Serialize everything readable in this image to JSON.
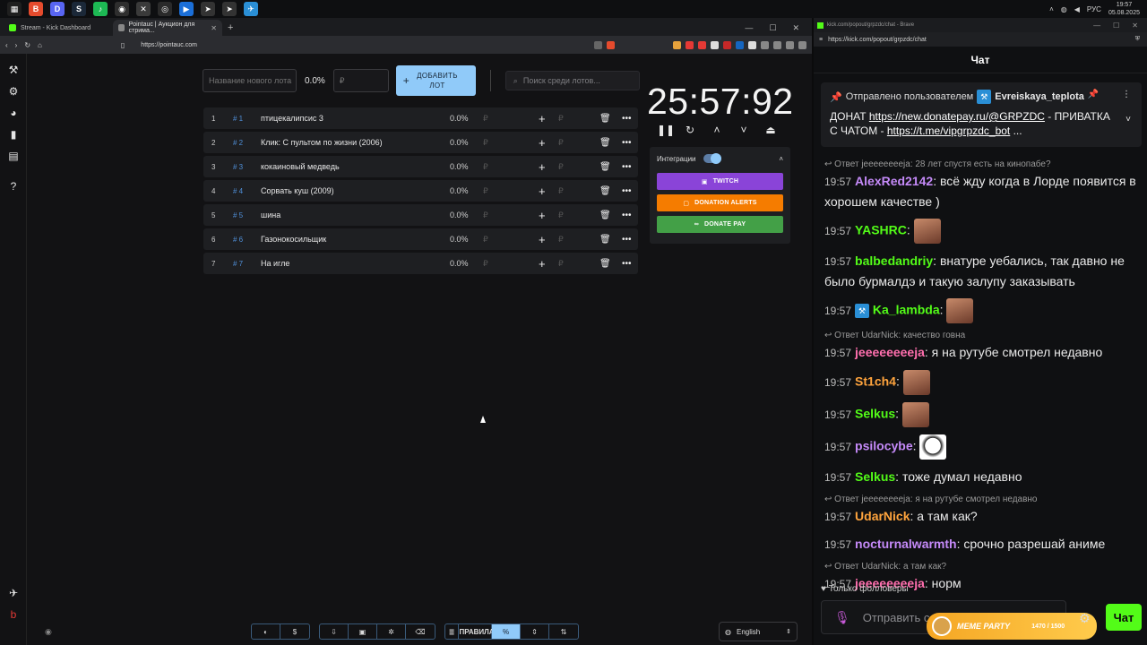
{
  "taskbar": {
    "lang": "РУС",
    "time": "19:57",
    "date": "05.08.2025"
  },
  "left_browser": {
    "tabs": [
      {
        "label": "Stream - Kick Dashboard"
      },
      {
        "label": "Pointauc | Аукцион для стрима..."
      }
    ],
    "url": "https://pointauc.com"
  },
  "auction": {
    "lot_name_placeholder": "Название нового лота",
    "new_lot_pct": "0.0%",
    "amount_placeholder": "₽",
    "add_button_line1": "ДОБАВИТЬ",
    "add_button_line2": "ЛОТ",
    "search_placeholder": "Поиск среди лотов...",
    "timer": "25:57:92",
    "integrations": {
      "label": "Интеграции",
      "twitch": "TWITCH",
      "donation_alerts": "DONATION ALERTS",
      "donate_pay": "DONATE PAY"
    },
    "lots": [
      {
        "idx": "1",
        "hash": "# 1",
        "name": "птицекалипсис 3",
        "pct": "0.0%",
        "rub": "₽"
      },
      {
        "idx": "2",
        "hash": "# 2",
        "name": "Клик: С пультом по жизни (2006)",
        "pct": "0.0%",
        "rub": "₽"
      },
      {
        "idx": "3",
        "hash": "# 3",
        "name": "кокаиновый медведь",
        "pct": "0.0%",
        "rub": "₽"
      },
      {
        "idx": "4",
        "hash": "# 4",
        "name": "Сорвать куш (2009)",
        "pct": "0.0%",
        "rub": "₽"
      },
      {
        "idx": "5",
        "hash": "# 5",
        "name": "шина",
        "pct": "0.0%",
        "rub": "₽"
      },
      {
        "idx": "6",
        "hash": "# 6",
        "name": "Газонокосильщик",
        "pct": "0.0%",
        "rub": "₽"
      },
      {
        "idx": "7",
        "hash": "# 7",
        "name": "На игле",
        "pct": "0.0%",
        "rub": "₽"
      }
    ],
    "rules_label": "ПРАВИЛА",
    "language": "English"
  },
  "right_browser": {
    "title": "kick.com/popout/grpzdc/chat - Brave",
    "url": "https://kick.com/popout/grpzdc/chat",
    "chat_header": "Чат",
    "pinned": {
      "by_prefix": "Отправлено пользователем",
      "by_user": "Evreiskaya_teplota",
      "text_1": "ДОНАТ ",
      "link_1": "https://new.donatepay.ru/@GRPZDC",
      "text_2": " - ПРИВАТКА С ЧАТОМ - ",
      "link_2": "https://t.me/vipgrpzdc_bot",
      "text_3": " ..."
    },
    "messages": [
      {
        "reply": "Ответ jeeeeeeeeja: 28 лет спустя есть на кинопабе?",
        "time": "19:57",
        "user": "AlexRed2142",
        "color": "#c58af9",
        "text": "всё жду когда в Лорде появится в хорошем качестве )"
      },
      {
        "reply": "",
        "time": "19:57",
        "user": "YASHRC",
        "color": "#53fc18",
        "text": "",
        "emote": true
      },
      {
        "reply": "",
        "time": "19:57",
        "user": "balbedandriy",
        "color": "#53fc18",
        "text": "внатуре уебались, так давно не было бурмалдэ и такую залупу заказывать"
      },
      {
        "reply": "",
        "time": "19:57",
        "user": "Ka_lambda",
        "color": "#53fc18",
        "text": "",
        "emote": true,
        "badge": true
      },
      {
        "reply": "Ответ UdarNick: качество говна",
        "time": "19:57",
        "user": "jeeeeeeeeja",
        "color": "#ff6fae",
        "text": "я на рутубе смотрел недавно"
      },
      {
        "reply": "",
        "time": "19:57",
        "user": "St1ch4",
        "color": "#ffa43d",
        "text": "",
        "emote": true
      },
      {
        "reply": "",
        "time": "19:57",
        "user": "Selkus",
        "color": "#53fc18",
        "text": "",
        "emote": true
      },
      {
        "reply": "",
        "time": "19:57",
        "user": "psilocybe",
        "color": "#c58af9",
        "text": "",
        "emote": "ghost"
      },
      {
        "reply": "",
        "time": "19:57",
        "user": "Selkus",
        "color": "#53fc18",
        "text": "тоже думал недавно"
      },
      {
        "reply": "Ответ jeeeeeeeeja: я на рутубе смотрел недавно",
        "time": "19:57",
        "user": "UdarNick",
        "color": "#ffa43d",
        "text": "а там как?"
      },
      {
        "reply": "",
        "time": "19:57",
        "user": "nocturnalwarmth",
        "color": "#c58af9",
        "text": "срочно разрешай аниме"
      },
      {
        "reply": "Ответ UdarNick: а там как?",
        "time": "19:57",
        "user": "jeeeeeeeeja",
        "color": "#ff6fae",
        "text": "норм"
      }
    ],
    "followers_only": "Только фолловеры",
    "input_placeholder": "Отправить со",
    "meme_party": "MEME PARTY",
    "meme_count": "1470 / 1500",
    "send_button": "Чат"
  }
}
